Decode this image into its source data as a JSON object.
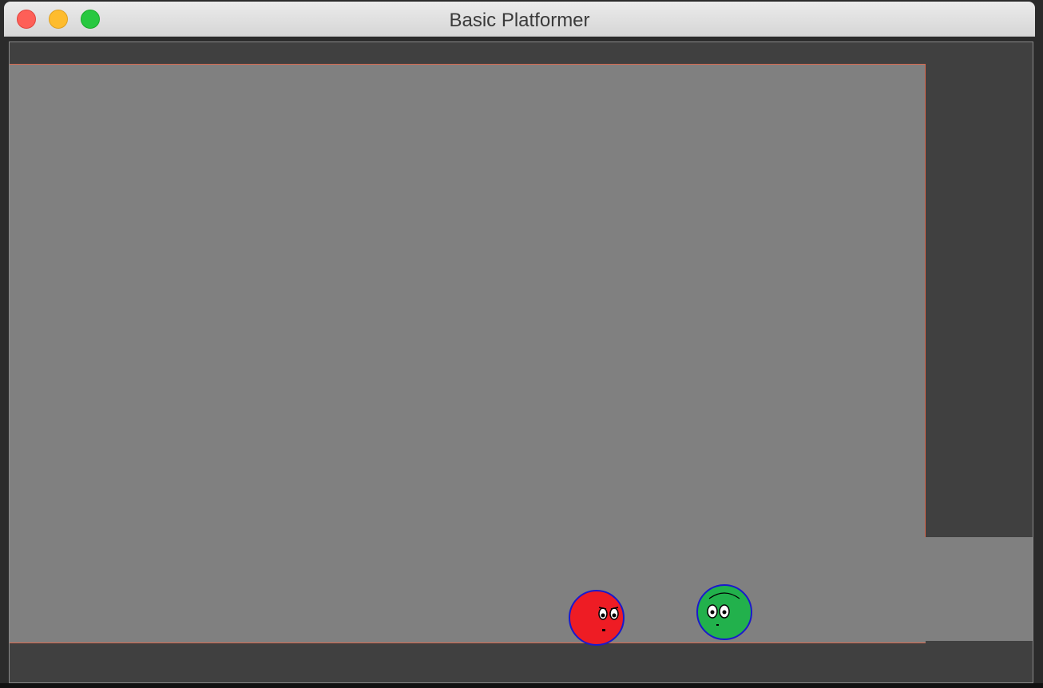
{
  "window": {
    "title": "Basic Platformer"
  },
  "colors": {
    "wall": "#404040",
    "background": "#808080",
    "boundary_line": "#d8694e",
    "player_red": "#ee1c24",
    "player_green": "#22b14c",
    "outline": "#1a1acc"
  },
  "players": [
    {
      "name": "red-ball",
      "color": "#ee1c24"
    },
    {
      "name": "green-ball",
      "color": "#22b14c"
    }
  ]
}
